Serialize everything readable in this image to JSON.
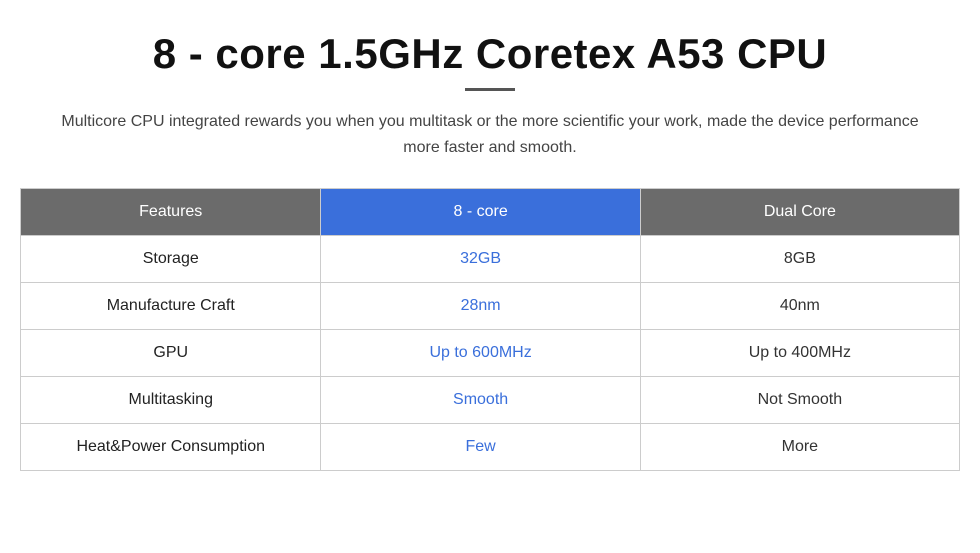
{
  "header": {
    "title": "8 - core 1.5GHz Coretex A53 CPU",
    "subtitle": "Multicore CPU integrated rewards you when you multitask or the more scientific your work, made the device performance more faster and smooth."
  },
  "table": {
    "headers": {
      "features": "Features",
      "col1": "8 - core",
      "col2": "Dual Core"
    },
    "rows": [
      {
        "label": "Storage",
        "col1": "32GB",
        "col2": "8GB"
      },
      {
        "label": "Manufacture Craft",
        "col1": "28nm",
        "col2": "40nm"
      },
      {
        "label": "GPU",
        "col1": "Up to 600MHz",
        "col2": "Up to 400MHz"
      },
      {
        "label": "Multitasking",
        "col1": "Smooth",
        "col2": "Not Smooth"
      },
      {
        "label": "Heat&Power Consumption",
        "col1": "Few",
        "col2": "More"
      }
    ]
  }
}
